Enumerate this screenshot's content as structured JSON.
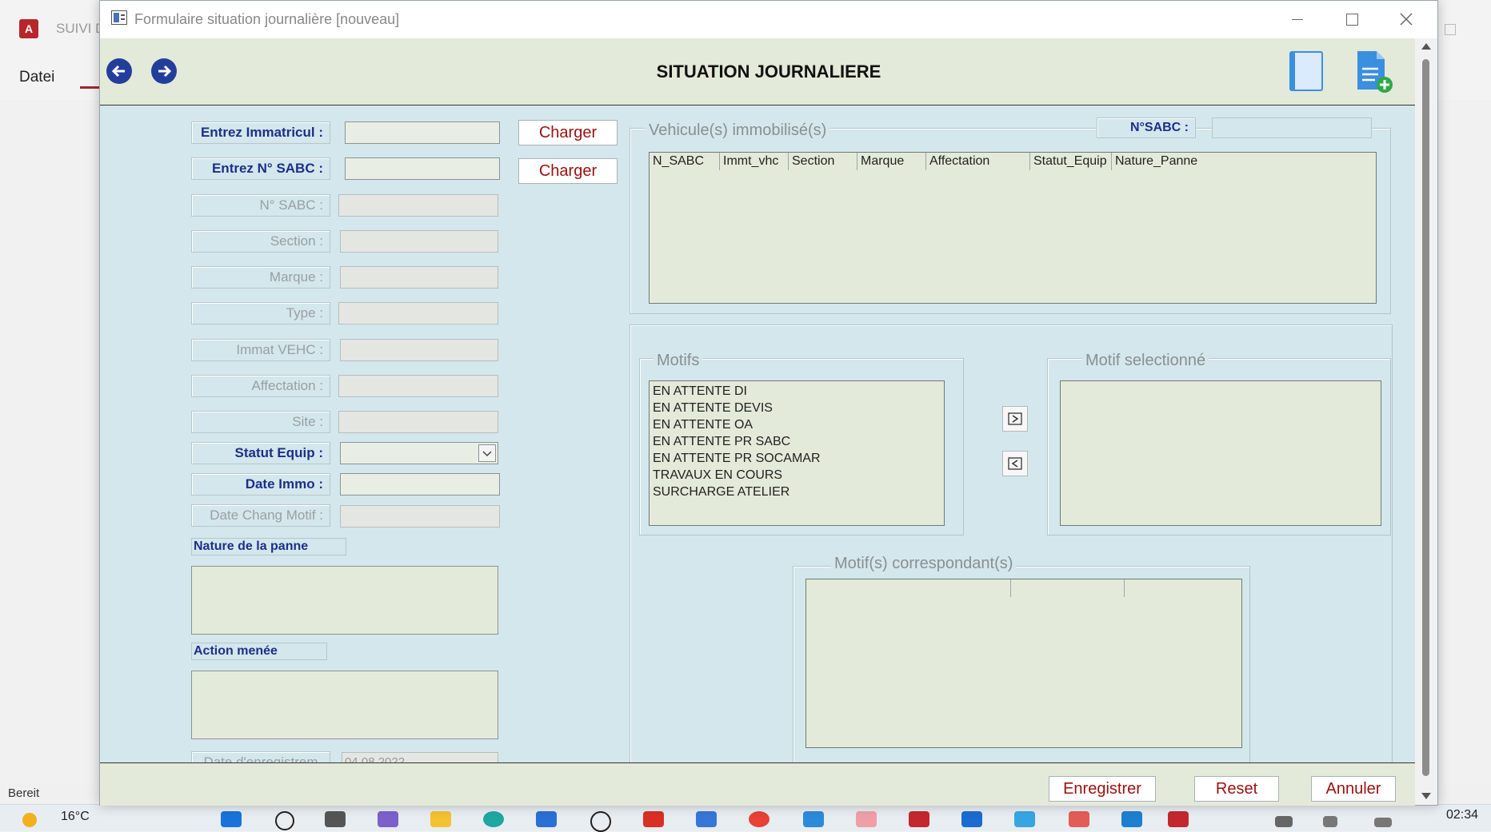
{
  "background_app": {
    "app_title_partial": "SUIVI D",
    "tab_label": "Datei",
    "status_text": "Bereit"
  },
  "taskbar": {
    "temperature": "16°C",
    "time": "02:34"
  },
  "window": {
    "title": "Formulaire situation journalière [nouveau]"
  },
  "header": {
    "title": "SITUATION JOURNALIERE"
  },
  "form": {
    "label_immatricul": "Entrez Immatricul :",
    "label_entrez_sabc": "Entrez N° SABC :",
    "label_n_sabc": "N° SABC :",
    "label_section": "Section :",
    "label_marque": "Marque :",
    "label_type": "Type :",
    "label_immat_vehc": "Immat VEHC :",
    "label_affectation": "Affectation :",
    "label_site": "Site :",
    "label_statut_equip": "Statut Equip :",
    "label_date_immo": "Date Immo :",
    "label_date_chang_motif": "Date Chang Motif :",
    "label_nature_panne": "Nature de la panne",
    "label_action_menee": "Action menée",
    "label_date_enregistrement": "Date d'enregistrem",
    "date_enregistrement_value": "04.08.2022",
    "charger_label": "Charger"
  },
  "vehicules": {
    "title": "Vehicule(s) immobilisé(s)",
    "sabc_label": "N°SABC :",
    "columns": [
      "N_SABC",
      "Immt_vhc",
      "Section",
      "Marque",
      "Affectation",
      "Statut_Equip",
      "Nature_Panne"
    ]
  },
  "motifs": {
    "title": "Motifs",
    "items": [
      "EN ATTENTE DI",
      "EN ATTENTE DEVIS",
      "EN ATTENTE OA",
      "EN ATTENTE PR SABC",
      "EN ATTENTE PR SOCAMAR",
      "TRAVAUX EN COURS",
      "SURCHARGE ATELIER"
    ],
    "selected_title": "Motif selectionné",
    "correspondant_title": "Motif(s) correspondant(s)"
  },
  "footer": {
    "save_label": "Enregistrer",
    "reset_label": "Reset",
    "cancel_label": "Annuler"
  },
  "colors": {
    "body_bg": "#d3e7ec",
    "header_bg": "#e3ead9",
    "label_text": "#1f2e8a",
    "button_text": "#9a1010"
  }
}
